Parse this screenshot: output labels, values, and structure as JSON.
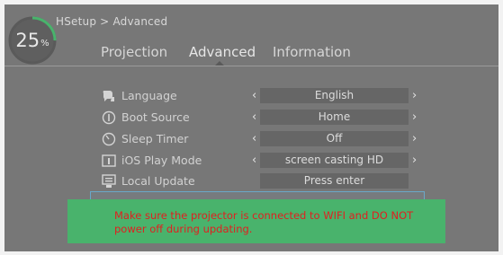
{
  "breadcrumb": {
    "hidden_start": "H",
    "text": "Setup > Advanced"
  },
  "progress": {
    "value": 25,
    "value_text": "25",
    "unit": "%",
    "track_color": "#5a5a5a",
    "arc_color": "#49b36c"
  },
  "tabs": [
    {
      "label": "Projection",
      "active": false
    },
    {
      "label": "Advanced",
      "active": true
    },
    {
      "label": "Information",
      "active": false
    }
  ],
  "settings": [
    {
      "label": "Language",
      "icon": "language-icon",
      "value": "English",
      "has_arrows": true
    },
    {
      "label": "Boot Source",
      "icon": "boot-source-icon",
      "value": "Home",
      "has_arrows": true
    },
    {
      "label": "Sleep Timer",
      "icon": "sleep-timer-icon",
      "value": "Off",
      "has_arrows": true
    },
    {
      "label": "iOS Play Mode",
      "icon": "ios-play-mode-icon",
      "value": "screen casting HD",
      "has_arrows": true
    },
    {
      "label": "Local Update",
      "icon": "local-update-icon",
      "value": "Press enter",
      "has_arrows": false
    }
  ],
  "arrows": {
    "left": "‹",
    "right": "›"
  },
  "toast": {
    "message": "Make sure the projector is connected to WIFI and DO NOT power off during updating."
  },
  "colors": {
    "background": "#777777",
    "accent": "#49b36c",
    "warning_text": "#e02020"
  }
}
